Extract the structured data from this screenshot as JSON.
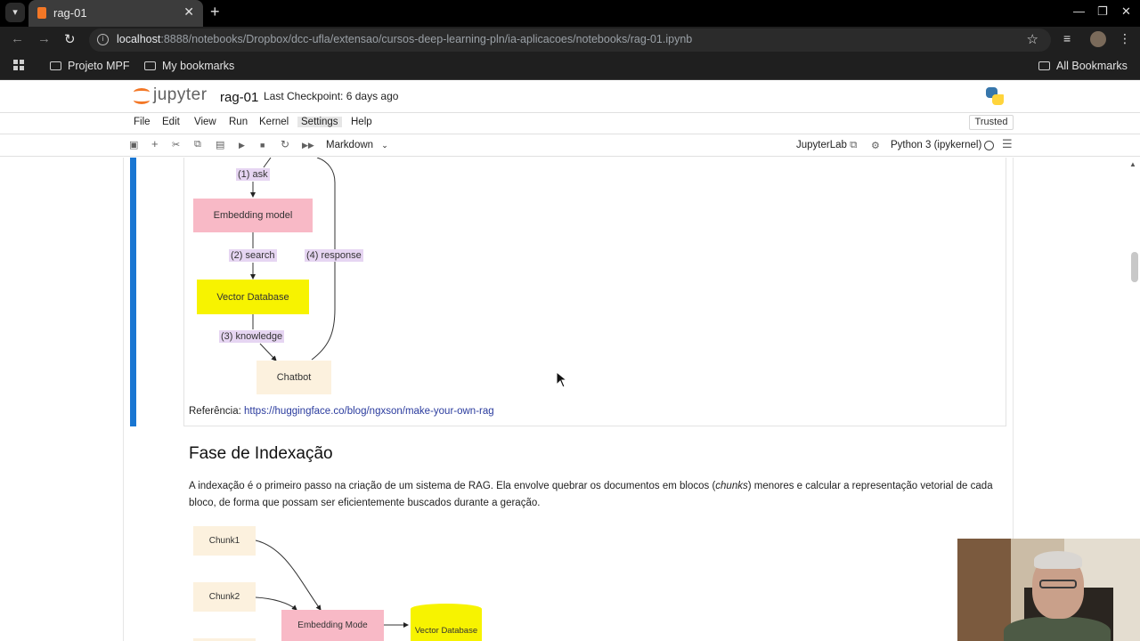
{
  "browser": {
    "tab_title": "rag-01",
    "url_host": "localhost",
    "url_rest": ":8888/notebooks/Dropbox/dcc-ufla/extensao/cursos-deep-learning-pln/ia-aplicacoes/notebooks/rag-01.ipynb",
    "bookmarks": [
      "Projeto MPF",
      "My bookmarks"
    ],
    "all_bookmarks": "All Bookmarks"
  },
  "jupyter": {
    "brand": "jupyter",
    "notebook_name": "rag-01",
    "checkpoint": "Last Checkpoint: 6 days ago",
    "menu": [
      "File",
      "Edit",
      "View",
      "Run",
      "Kernel",
      "Settings",
      "Help"
    ],
    "trusted": "Trusted",
    "cell_type": "Markdown",
    "jupyterlab_link": "JupyterLab",
    "kernel": "Python 3 (ipykernel)"
  },
  "diagram1": {
    "nodes": {
      "embedding": "Embedding model",
      "vector_db": "Vector Database",
      "chatbot": "Chatbot"
    },
    "edges": {
      "ask": "(1) ask",
      "search": "(2) search",
      "response": "(4) response",
      "knowledge": "(3) knowledge"
    }
  },
  "reference": {
    "label": "Referência:",
    "link": "https://huggingface.co/blog/ngxson/make-your-own-rag"
  },
  "section": {
    "title": "Fase de Indexação",
    "para_before": "A indexação é o primeiro passo na criação de um sistema de RAG. Ela envolve quebrar os documentos em blocos (",
    "para_em": "chunks",
    "para_after": ") menores e calcular a representação vetorial de cada bloco, de forma que possam ser eficientemente buscados durante a geração."
  },
  "diagram2": {
    "chunk1": "Chunk1",
    "chunk2": "Chunk2",
    "embedding": "Embedding Mode",
    "vector_db": "Vector Database"
  },
  "colors": {
    "embedding_node": "#f8b9c6",
    "vector_db_node": "#f7f300",
    "chatbot_node": "#fcf1de",
    "edge_label": "#e6d5f2",
    "active_cell": "#1976d2",
    "jupyter_orange": "#f37726"
  }
}
